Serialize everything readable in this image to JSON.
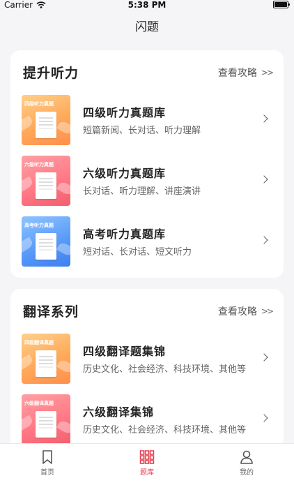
{
  "status": {
    "carrier": "Carrier",
    "time": "5:38 PM"
  },
  "nav": {
    "title": "闪题"
  },
  "sections": [
    {
      "title": "提升听力",
      "link": "查看攻略",
      "link_chevron": ">>",
      "items": [
        {
          "title": "四级听力真题库",
          "subtitle": "短篇新闻、长对话、听力理解",
          "thumb_label": "四级听力真题",
          "thumb_color": "#ffa95a"
        },
        {
          "title": "六级听力真题库",
          "subtitle": "长对话、听力理解、讲座演讲",
          "thumb_label": "六级听力真题",
          "thumb_color": "#ff7a86"
        },
        {
          "title": "高考听力真题库",
          "subtitle": "短对话、长对话、短文听力",
          "thumb_label": "高考听力真题",
          "thumb_color": "#5a9cf8"
        }
      ]
    },
    {
      "title": "翻译系列",
      "link": "查看攻略",
      "link_chevron": ">>",
      "items": [
        {
          "title": "四级翻译题集锦",
          "subtitle": "历史文化、社会经济、科技环境、其他等",
          "thumb_label": "四级翻译真题",
          "thumb_color": "#ffa95a"
        },
        {
          "title": "六级翻译集锦",
          "subtitle": "历史文化、社会经济、科技环境、其他等",
          "thumb_label": "六级翻译真题",
          "thumb_color": "#ff7a86"
        }
      ]
    }
  ],
  "tabs": [
    {
      "label": "首页",
      "icon": "bookmark-icon",
      "active": false
    },
    {
      "label": "题库",
      "icon": "grid-icon",
      "active": true,
      "active_color": "#e5394b"
    },
    {
      "label": "我的",
      "icon": "person-icon",
      "active": false
    }
  ]
}
